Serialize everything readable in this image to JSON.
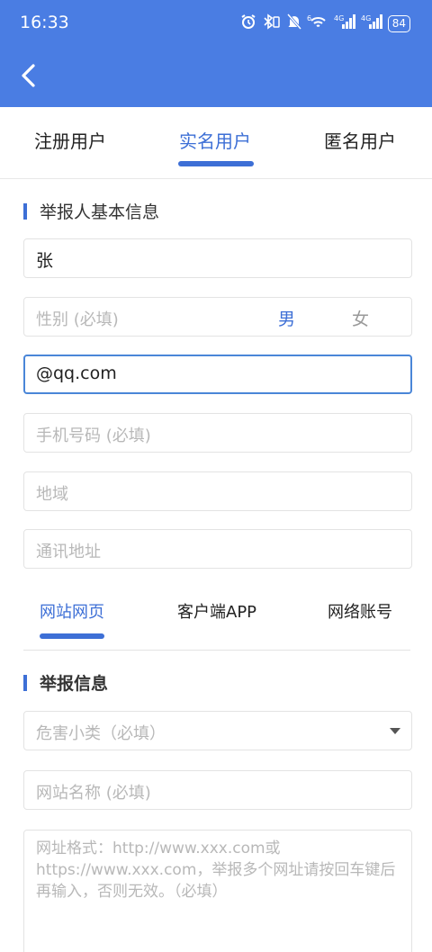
{
  "status_bar": {
    "time": "16:33",
    "icons": [
      "alarm-icon",
      "bluetooth-icon",
      "silent-icon",
      "wifi-icon",
      "signal-4g-icon",
      "signal-4g-icon"
    ],
    "wifi_label": "6",
    "signal1_label": "4G",
    "signal2_label": "4G",
    "battery": "84"
  },
  "colors": {
    "header": "#4a7de3",
    "accent": "#3d6fd6"
  },
  "user_tabs": {
    "registered": "注册用户",
    "realname": "实名用户",
    "anonymous": "匿名用户",
    "active": "realname"
  },
  "basic_info": {
    "section_title": "举报人基本信息",
    "name_value": "张",
    "gender_placeholder": "性别 (必填)",
    "gender_male": "男",
    "gender_female": "女",
    "gender_selected": "男",
    "email_value": "@qq.com",
    "phone_placeholder": "手机号码 (必填)",
    "region_placeholder": "地域",
    "address_placeholder": "通讯地址"
  },
  "site_tabs": {
    "web": "网站网页",
    "app": "客户端APP",
    "account": "网络账号",
    "active": "web"
  },
  "report_info": {
    "section_title": "举报信息",
    "category_placeholder": "危害小类（必填）",
    "site_name_placeholder": "网站名称 (必填)",
    "url_placeholder": "网址格式：http://www.xxx.com或https://www.xxx.com，举报多个网址请按回车键后再输入，否则无效。（必填）"
  }
}
